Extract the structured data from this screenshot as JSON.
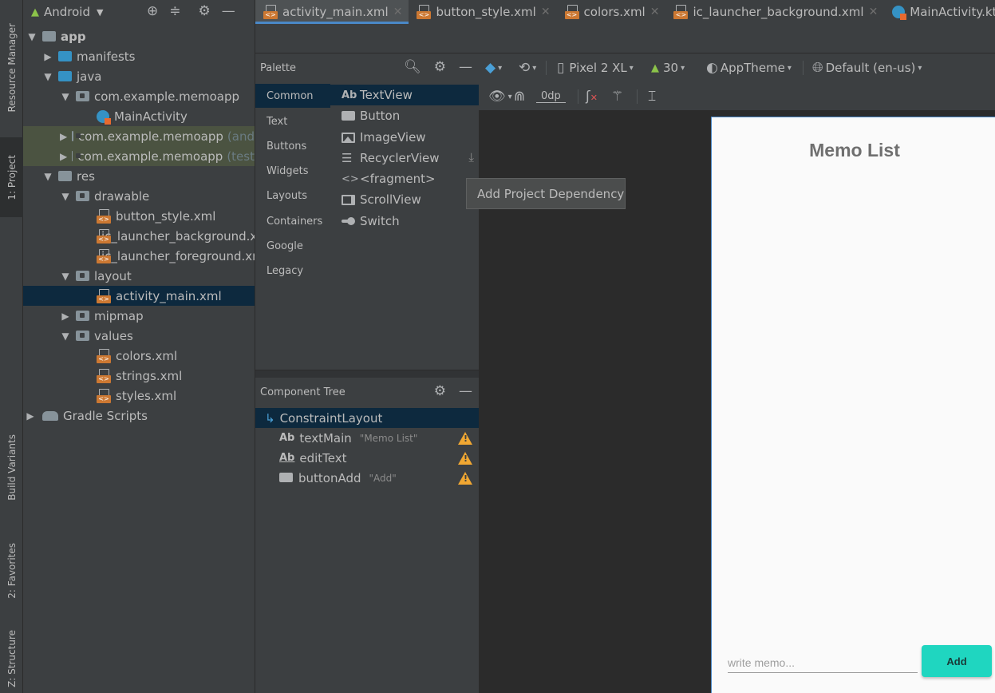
{
  "toolstrip": {
    "resource_manager": "Resource Manager",
    "project": "1: Project",
    "build_variants": "Build Variants",
    "favorites": "2: Favorites",
    "structure": "Z: Structure"
  },
  "project_panel": {
    "view_label": "Android",
    "tree": [
      {
        "label": "app",
        "note": ""
      },
      {
        "label": "manifests",
        "note": ""
      },
      {
        "label": "java",
        "note": ""
      },
      {
        "label": "com.example.memoapp",
        "note": ""
      },
      {
        "label": "MainActivity",
        "note": ""
      },
      {
        "label": "com.example.memoapp",
        "note": "(and"
      },
      {
        "label": "com.example.memoapp",
        "note": "(test"
      },
      {
        "label": "res",
        "note": ""
      },
      {
        "label": "drawable",
        "note": ""
      },
      {
        "label": "button_style.xml",
        "note": ""
      },
      {
        "label": "ic_launcher_background.x",
        "note": ""
      },
      {
        "label": "ic_launcher_foreground.xr",
        "note": ""
      },
      {
        "label": "layout",
        "note": ""
      },
      {
        "label": "activity_main.xml",
        "note": ""
      },
      {
        "label": "mipmap",
        "note": ""
      },
      {
        "label": "values",
        "note": ""
      },
      {
        "label": "colors.xml",
        "note": ""
      },
      {
        "label": "strings.xml",
        "note": ""
      },
      {
        "label": "styles.xml",
        "note": ""
      },
      {
        "label": "Gradle Scripts",
        "note": ""
      }
    ]
  },
  "editor_tabs": [
    {
      "label": "activity_main.xml",
      "active": true
    },
    {
      "label": "button_style.xml",
      "active": false
    },
    {
      "label": "colors.xml",
      "active": false
    },
    {
      "label": "ic_launcher_background.xml",
      "active": false
    },
    {
      "label": "MainActivity.kt",
      "active": false
    }
  ],
  "palette": {
    "title": "Palette",
    "categories": [
      "Common",
      "Text",
      "Buttons",
      "Widgets",
      "Layouts",
      "Containers",
      "Google",
      "Legacy"
    ],
    "selected_category": "Common",
    "items": [
      "TextView",
      "Button",
      "ImageView",
      "RecyclerView",
      "<fragment>",
      "ScrollView",
      "Switch"
    ],
    "textview_icon": "Ab",
    "fragment_icon": "<>"
  },
  "tooltip": "Add Project Dependency",
  "component_tree": {
    "title": "Component Tree",
    "rows": [
      {
        "label": "ConstraintLayout",
        "quote": ""
      },
      {
        "label": "textMain",
        "quote": "\"Memo List\""
      },
      {
        "label": "editText",
        "quote": ""
      },
      {
        "label": "buttonAdd",
        "quote": "\"Add\""
      }
    ],
    "ab_icon": "Ab"
  },
  "design_toolbar": {
    "device": "Pixel 2 XL",
    "api": "30",
    "theme": "AppTheme",
    "locale": "Default (en-us)",
    "margin": "0dp"
  },
  "preview": {
    "title": "Memo List",
    "input_placeholder": "write memo...",
    "button_label": "Add",
    "accent_color": "#1fd6c0"
  }
}
